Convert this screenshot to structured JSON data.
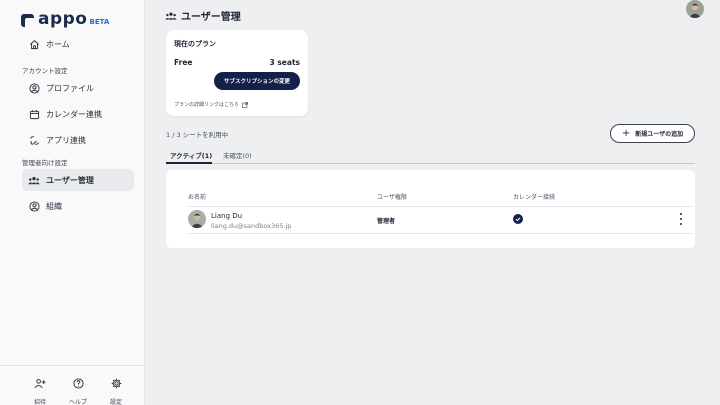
{
  "app": {
    "logo_text": "appo",
    "logo_badge": "BETA"
  },
  "sidebar": {
    "items": [
      {
        "label": "ホーム",
        "icon": "home-icon"
      },
      {
        "label": "プロファイル",
        "icon": "user-circle-icon"
      },
      {
        "label": "カレンダー連携",
        "icon": "calendar-icon"
      },
      {
        "label": "アプリ連携",
        "icon": "link-icon"
      },
      {
        "label": "ユーザー管理",
        "icon": "users-icon",
        "active": true
      },
      {
        "label": "組織",
        "icon": "building-icon"
      }
    ],
    "sections": {
      "account": "アカウント設定",
      "admin": "管理者向け設定"
    },
    "footer": [
      {
        "label": "招待",
        "icon": "invite-icon"
      },
      {
        "label": "ヘルプ",
        "icon": "help-icon"
      },
      {
        "label": "設定",
        "icon": "gear-icon"
      }
    ]
  },
  "header": {
    "title": "ユーザー管理",
    "icon": "users-icon"
  },
  "plan": {
    "title": "現在のプラン",
    "name": "Free",
    "seats": "3 seats",
    "change_button": "サブスクリプションの変更",
    "details_link": "プランの詳細リンクはこちら"
  },
  "seat_usage": "1 / 3 シートを利用中",
  "add_user_button": "新規ユーザの追加",
  "tabs": [
    {
      "label": "アクティブ(1)",
      "active": true
    },
    {
      "label": "未確定(0)",
      "active": false
    }
  ],
  "table": {
    "columns": [
      "お名前",
      "ユーザ権限",
      "カレンダー接続"
    ],
    "rows": [
      {
        "name": "Liang Du",
        "email": "liang.du@sandbox365.jp",
        "role": "管理者",
        "calendar_connected": true
      }
    ]
  },
  "colors": {
    "primary": "#15204a",
    "logo": "#1d2b4f",
    "beta": "#1d6fd1",
    "background": "#eeeff1"
  }
}
